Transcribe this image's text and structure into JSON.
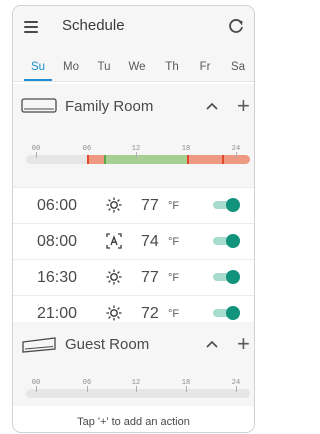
{
  "header": {
    "title": "Schedule"
  },
  "days": [
    {
      "label": "Su",
      "active": true
    },
    {
      "label": "Mo",
      "active": false
    },
    {
      "label": "Tu",
      "active": false
    },
    {
      "label": "We",
      "active": false
    },
    {
      "label": "Th",
      "active": false
    },
    {
      "label": "Fr",
      "active": false
    },
    {
      "label": "Sa",
      "active": false
    }
  ],
  "timeline_ticks": [
    "00",
    "06",
    "12",
    "18",
    "24"
  ],
  "rooms": [
    {
      "name": "Family Room",
      "entries": [
        {
          "time": "06:00",
          "mode": "heat",
          "temp": "77",
          "unit": "°F",
          "enabled": true
        },
        {
          "time": "08:00",
          "mode": "auto",
          "temp": "74",
          "unit": "°F",
          "enabled": true
        },
        {
          "time": "16:30",
          "mode": "heat",
          "temp": "77",
          "unit": "°F",
          "enabled": true
        },
        {
          "time": "21:00",
          "mode": "heat",
          "temp": "72",
          "unit": "°F",
          "enabled": true
        }
      ]
    },
    {
      "name": "Guest Room",
      "entries": [],
      "empty_hint": "Tap '+' to add an action"
    }
  ],
  "colors": {
    "accent": "#1b8fcf",
    "heat": "#ee9a83",
    "auto": "#a7cf94",
    "toggle": "#12937b"
  }
}
